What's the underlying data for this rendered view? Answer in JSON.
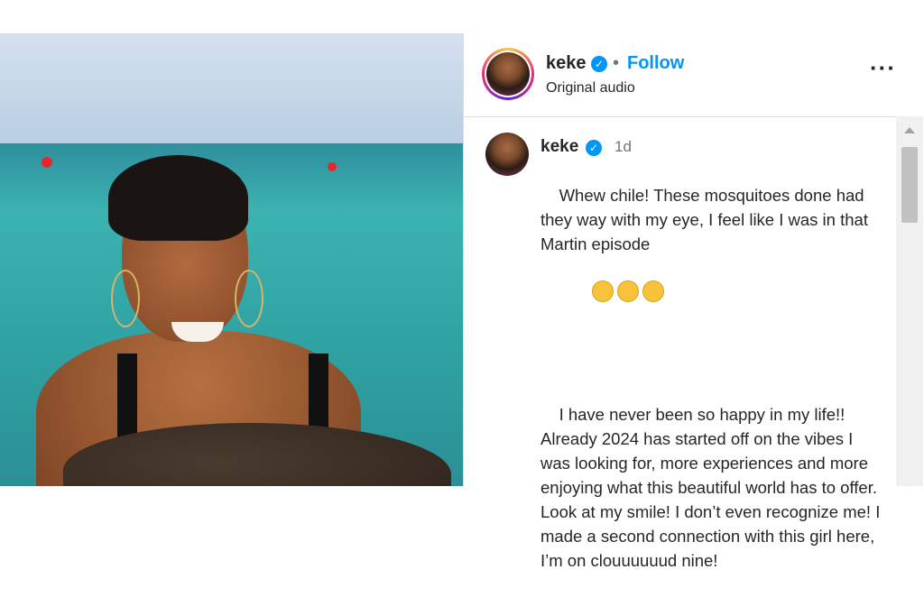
{
  "post": {
    "username": "keke",
    "follow_label": "Follow",
    "separator": "•",
    "audio_label": "Original audio",
    "more_icon": "more-horizontal-icon"
  },
  "caption": {
    "username": "keke",
    "time": "1d",
    "line1": "Whew chile! These mosquitoes done had they way with my eye, I feel like I was in that Martin episode",
    "emoji": "🤣🤣🤣",
    "line2": "I have never been so happy in my life!! Already 2024 has started off on the vibes I was looking for, more experiences and more enjoying what this beautiful world has to offer. Look at my smile! I don’t even recognize me! I made a second connection with this girl here, I’m on clouuuuuud nine!"
  },
  "colors": {
    "accent": "#0095f6",
    "text": "#262626",
    "muted": "#737373",
    "divider": "#dbdbdb"
  }
}
